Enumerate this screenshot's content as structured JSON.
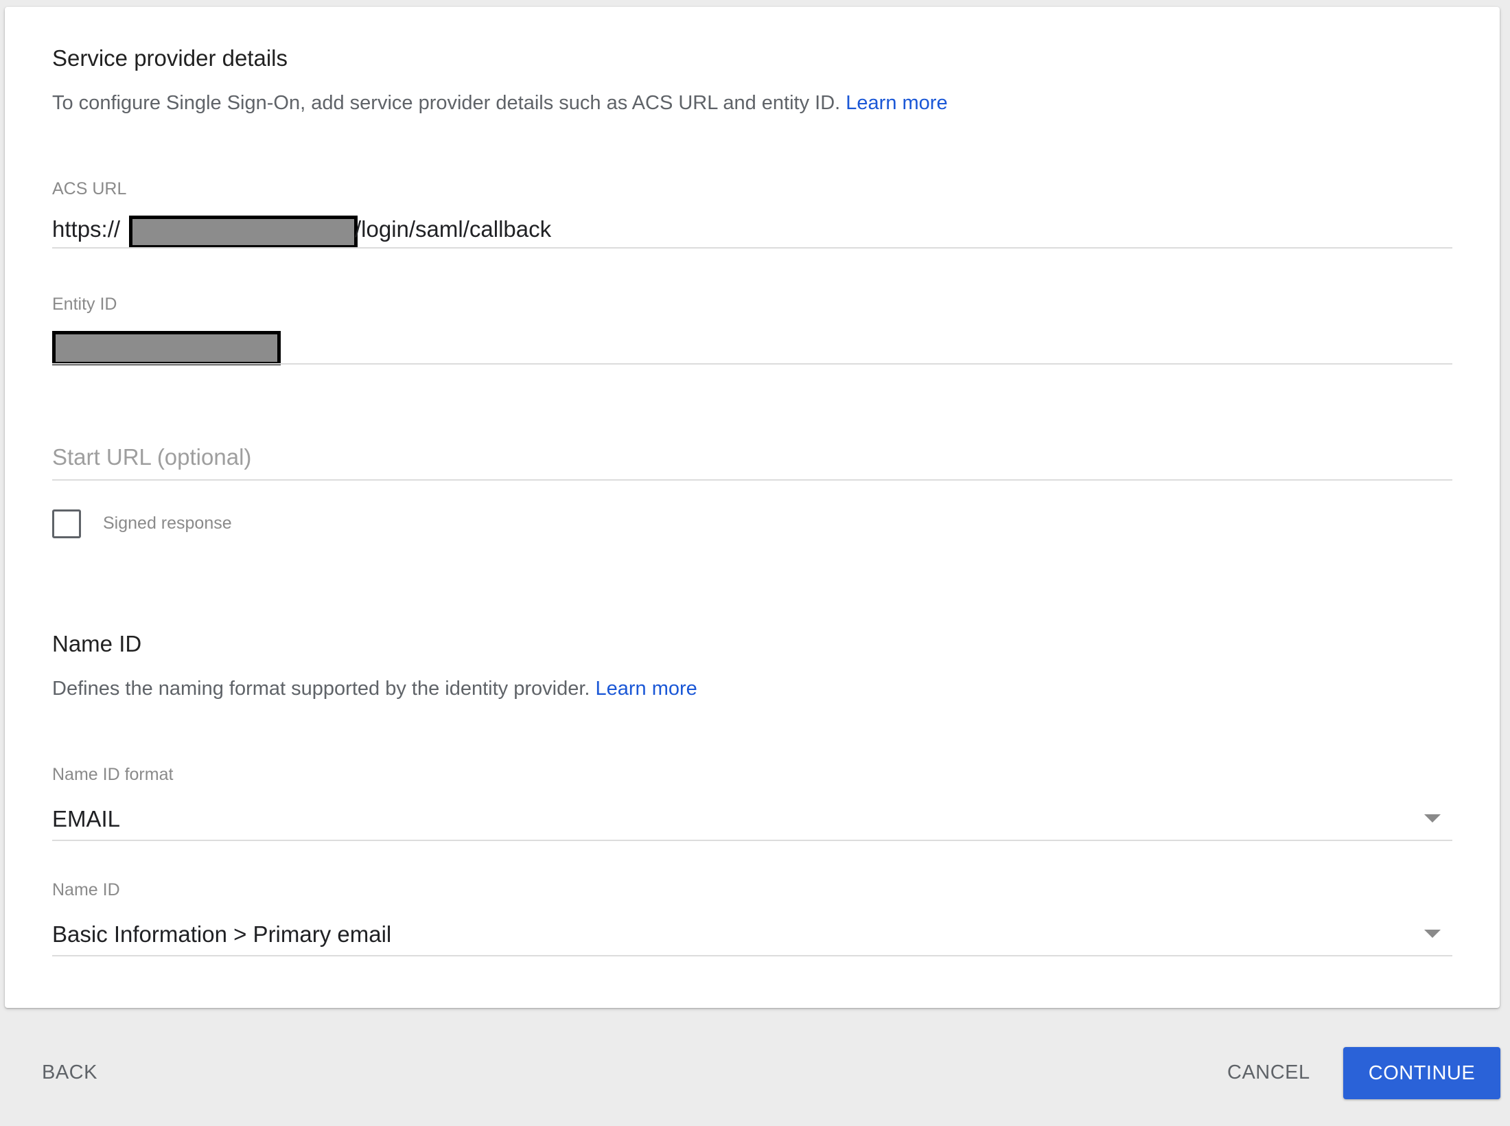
{
  "service_provider": {
    "title": "Service provider details",
    "description": "To configure Single Sign-On, add service provider details such as ACS URL and entity ID.",
    "learn_more": "Learn more",
    "acs_url": {
      "label": "ACS URL",
      "prefix": "https://",
      "suffix": "/login/saml/callback"
    },
    "entity_id": {
      "label": "Entity ID"
    },
    "start_url": {
      "placeholder": "Start URL (optional)"
    },
    "signed_response": {
      "label": "Signed response",
      "checked": false
    }
  },
  "name_id_section": {
    "title": "Name ID",
    "description": "Defines the naming format supported by the identity provider.",
    "learn_more": "Learn more",
    "format": {
      "label": "Name ID format",
      "value": "EMAIL"
    },
    "name_id": {
      "label": "Name ID",
      "value": "Basic Information > Primary email"
    }
  },
  "footer": {
    "back": "BACK",
    "cancel": "CANCEL",
    "continue": "CONTINUE"
  },
  "colors": {
    "accent": "#2a62d8",
    "link": "#1a57d6",
    "redaction": "#8c8c8c"
  }
}
